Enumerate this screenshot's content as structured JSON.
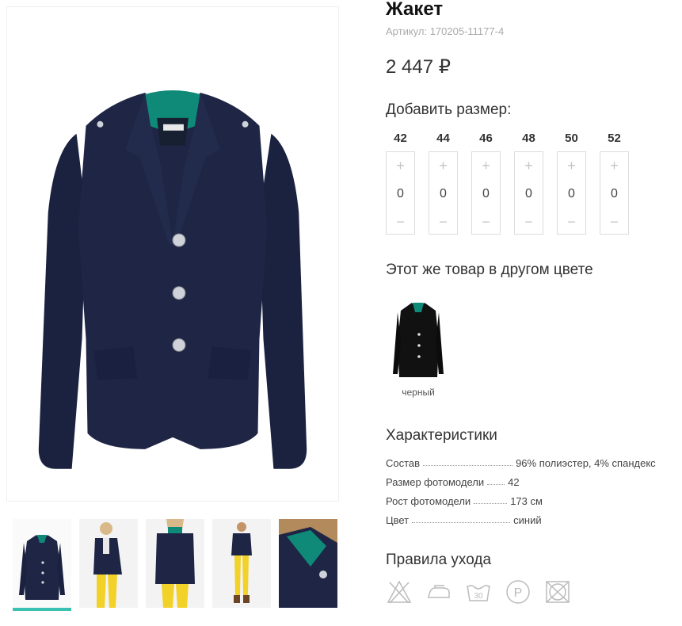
{
  "product": {
    "title": "Жакет",
    "sku": "Артикул: 170205-11177-4",
    "price": "2 447 ₽"
  },
  "sizes_section": {
    "heading": "Добавить размер:",
    "plus_symbol": "+",
    "minus_symbol": "−",
    "items": [
      {
        "size": "42",
        "qty": "0"
      },
      {
        "size": "44",
        "qty": "0"
      },
      {
        "size": "46",
        "qty": "0"
      },
      {
        "size": "48",
        "qty": "0"
      },
      {
        "size": "50",
        "qty": "0"
      },
      {
        "size": "52",
        "qty": "0"
      }
    ]
  },
  "colors_section": {
    "heading": "Этот же товар в другом цвете",
    "items": [
      {
        "label": "черный"
      }
    ]
  },
  "specs_section": {
    "heading": "Характеристики",
    "rows": [
      {
        "key": "Состав",
        "value": "96% полиэстер, 4% спандекс"
      },
      {
        "key": "Размер фотомодели",
        "value": "42"
      },
      {
        "key": "Рост фотомодели",
        "value": "173 см"
      },
      {
        "key": "Цвет",
        "value": "синий"
      }
    ]
  },
  "care_section": {
    "heading": "Правила ухода",
    "icons": [
      "no-bleach-icon",
      "iron-icon",
      "wash-30-icon",
      "dry-clean-p-icon",
      "no-tumble-dry-icon"
    ],
    "wash_temp": "30",
    "dry_clean_letter": "P"
  },
  "colors": {
    "accent": "#3bc0b4",
    "jacket_navy": "#1c2340",
    "lining_green": "#0f8a78"
  }
}
